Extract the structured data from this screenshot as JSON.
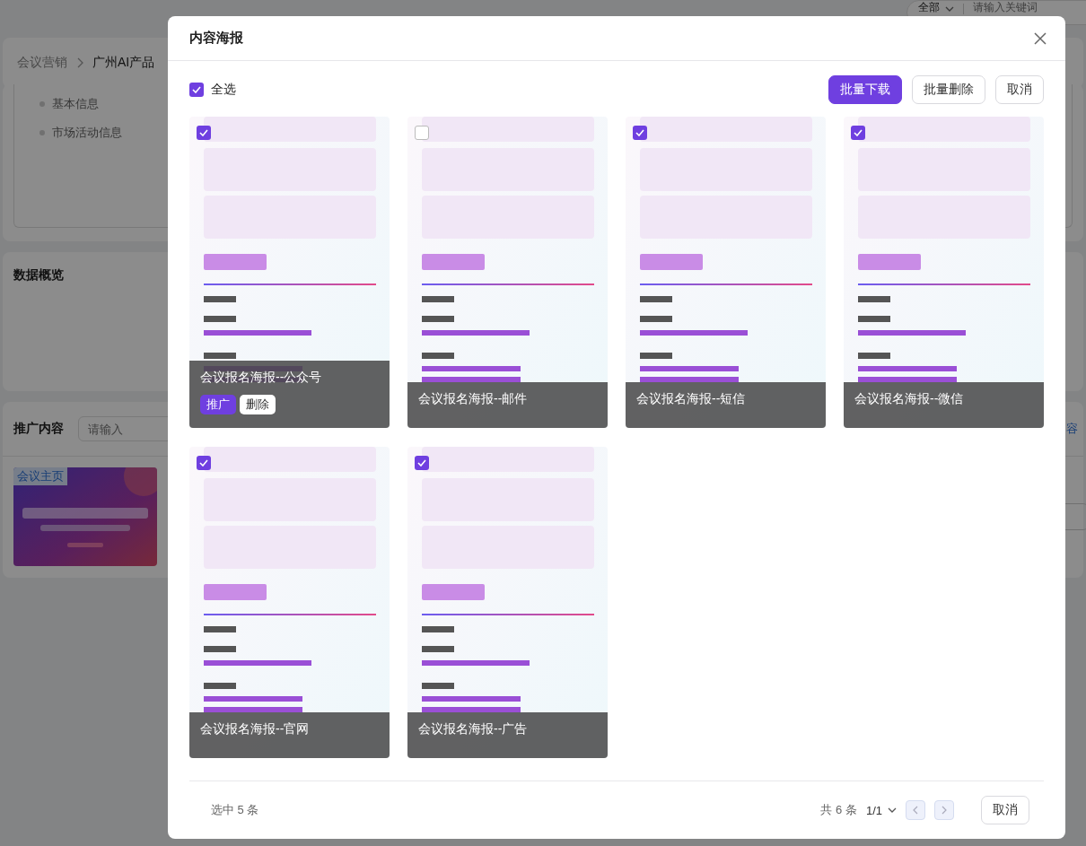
{
  "page": {
    "filter": {
      "value": "全部",
      "placeholder": "请输入关键词"
    },
    "breadcrumb": [
      "会议营销",
      "广州AI产品"
    ],
    "info_items": [
      "基本信息",
      "市场活动信息"
    ],
    "overview_title": "数据概览",
    "promo": {
      "title": "推广内容",
      "search_placeholder": "请输入",
      "link": "容",
      "thumbnail_tag": "会议主页"
    }
  },
  "modal": {
    "title": "内容海报",
    "select_all": {
      "label": "全选",
      "checked": true
    },
    "actions": [
      {
        "label": "批量下载",
        "kind": "primary"
      },
      {
        "label": "批量删除",
        "kind": "default"
      },
      {
        "label": "取消",
        "kind": "default"
      }
    ],
    "posters": [
      {
        "name": "会议报名海报--公众号",
        "selected": true,
        "hovered": true,
        "buttons": [
          {
            "label": "推广",
            "kind": "primary"
          },
          {
            "label": "删除",
            "kind": "default"
          }
        ]
      },
      {
        "name": "会议报名海报--邮件",
        "selected": false,
        "hovered": false
      },
      {
        "name": "会议报名海报--短信",
        "selected": true,
        "hovered": false
      },
      {
        "name": "会议报名海报--微信",
        "selected": true,
        "hovered": false
      },
      {
        "name": "会议报名海报--官网",
        "selected": true,
        "hovered": false
      },
      {
        "name": "会议报名海报--广告",
        "selected": true,
        "hovered": false
      }
    ],
    "footer": {
      "selected_count": "选中 5 条",
      "total": "共 6 条",
      "page": "1/1",
      "cancel": "取消"
    }
  }
}
